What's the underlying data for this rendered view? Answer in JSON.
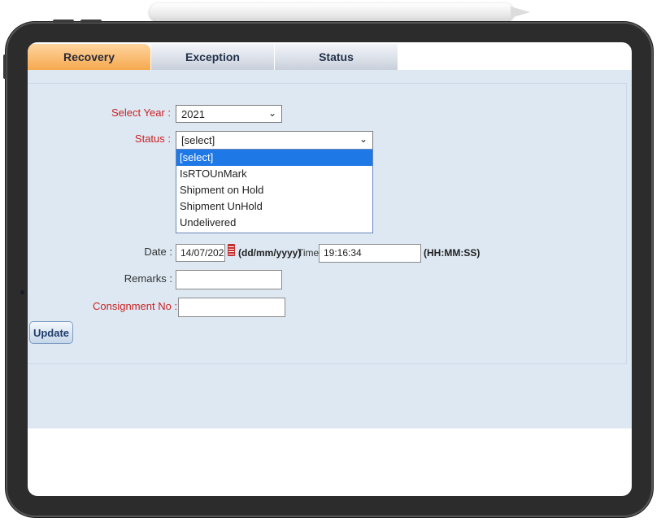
{
  "tabs": [
    {
      "label": "Recovery"
    },
    {
      "label": "Exception"
    },
    {
      "label": "Status"
    }
  ],
  "form": {
    "select_year_label": "Select Year :",
    "select_year_value": "2021",
    "status_label": "Status :",
    "status_value": "[select]",
    "status_options": [
      "[select]",
      "IsRTOUnMark",
      "Shipment on Hold",
      "Shipment UnHold",
      "Undelivered"
    ],
    "date_label": "Date :",
    "date_value": "14/07/202",
    "date_format": "(dd/mm/yyyy)",
    "time_label": "Time:",
    "time_value": "19:16:34",
    "time_format": "(HH:MM:SS)",
    "remarks_label": "Remarks :",
    "remarks_value": "",
    "consignment_label": "Consignment No :",
    "consignment_value": "",
    "update_label": "Update"
  },
  "icons": {
    "calendar": "calendar-icon",
    "dropdown": "chevron-down-icon"
  },
  "colors": {
    "active_tab": "#f6a94e",
    "panel_bg": "#dde8f3",
    "label_red": "#cc2222",
    "selected_option": "#1e78e6"
  }
}
